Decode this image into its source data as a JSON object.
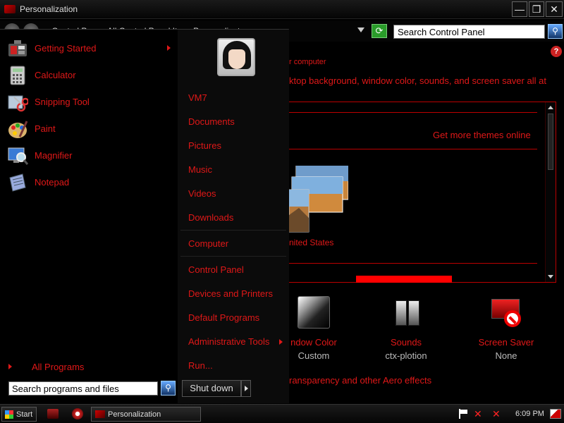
{
  "window": {
    "title": "Personalization",
    "min_glyph": "—",
    "max_glyph": "❐",
    "close_glyph": "✕"
  },
  "address": {
    "breadcrumb": "▸ Control Pa...  ▸ All Control Panel It...  ▸ Personalizat...",
    "search_text": "Search Control Panel",
    "search_icon_glyph": "⚲",
    "refresh_glyph": "⟳"
  },
  "content": {
    "subtitle": "r computer",
    "description": "ktop background, window color, sounds, and screen saver all at",
    "get_more_themes": "Get more themes online",
    "theme_label": "nited States",
    "items": [
      {
        "label": "ndow Color",
        "value": "Custom"
      },
      {
        "label": "Sounds",
        "value": "ctx-plotion"
      },
      {
        "label": "Screen Saver",
        "value": "None"
      }
    ],
    "transparency_link": "ransparency and other Aero effects",
    "help_glyph": "?"
  },
  "start_menu": {
    "programs": [
      {
        "label": "Getting Started",
        "icon": "getting-started-icon",
        "has_submenu": true
      },
      {
        "label": "Calculator",
        "icon": "calculator-icon",
        "has_submenu": false
      },
      {
        "label": "Snipping Tool",
        "icon": "snipping-tool-icon",
        "has_submenu": false
      },
      {
        "label": "Paint",
        "icon": "paint-icon",
        "has_submenu": false
      },
      {
        "label": "Magnifier",
        "icon": "magnifier-icon",
        "has_submenu": false
      },
      {
        "label": "Notepad",
        "icon": "notepad-icon",
        "has_submenu": false
      }
    ],
    "all_programs": "All Programs",
    "search_text": "Search programs and files",
    "search_icon_glyph": "⚲",
    "right_links": {
      "user": "VM7",
      "documents": "Documents",
      "pictures": "Pictures",
      "music": "Music",
      "videos": "Videos",
      "downloads": "Downloads",
      "computer": "Computer",
      "control_panel": "Control Panel",
      "devices": "Devices and Printers",
      "default_programs": "Default Programs",
      "admin_tools": "Administrative Tools",
      "run": "Run..."
    },
    "shutdown": "Shut down"
  },
  "taskbar": {
    "start_label": "Start",
    "task_label": "Personalization",
    "clock": "6:09 PM",
    "net_glyph": "✕",
    "vol_glyph": "✕"
  },
  "colors": {
    "accent": "#e01818",
    "background": "#000000",
    "highlight_bar": "#ff0000"
  }
}
